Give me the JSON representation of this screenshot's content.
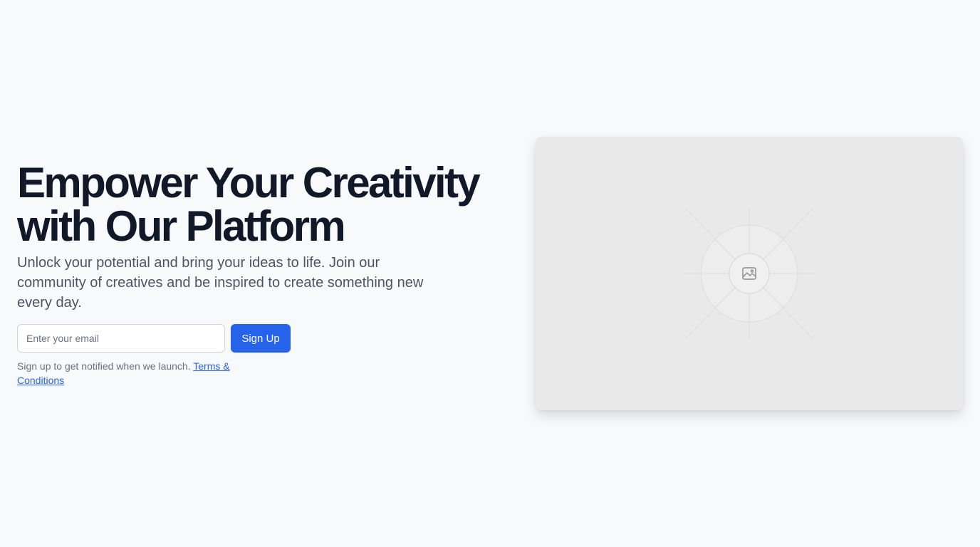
{
  "hero": {
    "headline_line1": "Empower Your Creativity",
    "headline_line2": "with Our Platform",
    "description": "Unlock your potential and bring your ideas to life. Join our community of creatives and be inspired to create something new every day."
  },
  "signup": {
    "email_placeholder": "Enter your email",
    "button_label": "Sign Up",
    "note_text": "Sign up to get notified when we launch. ",
    "terms_link": "Terms & Conditions"
  },
  "media": {
    "icon": "image-icon"
  },
  "colors": {
    "background": "#f8f9fb",
    "headline": "#111827",
    "body_text": "#4b5563",
    "accent": "#2563eb",
    "card": "#e9e9e9"
  }
}
